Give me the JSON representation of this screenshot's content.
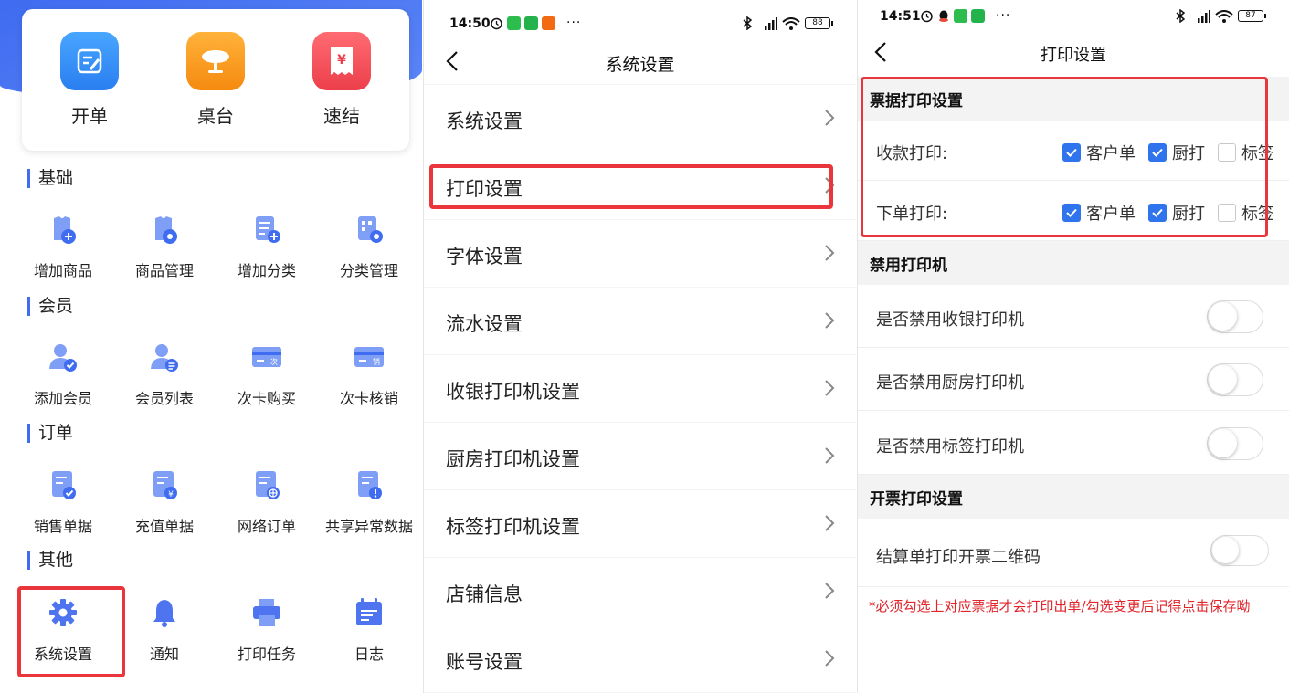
{
  "panel1": {
    "quick_actions": [
      {
        "label": "开单",
        "icon": "edit-order-icon",
        "color": "#2f8ef6"
      },
      {
        "label": "桌台",
        "icon": "table-icon",
        "color": "#f79a18"
      },
      {
        "label": "速结",
        "icon": "quick-checkout-icon",
        "color": "#f0505a"
      }
    ],
    "sections": [
      {
        "title": "基础",
        "items": [
          {
            "label": "增加商品",
            "icon": "add-product-icon"
          },
          {
            "label": "商品管理",
            "icon": "product-manage-icon"
          },
          {
            "label": "增加分类",
            "icon": "add-category-icon"
          },
          {
            "label": "分类管理",
            "icon": "category-manage-icon"
          }
        ]
      },
      {
        "title": "会员",
        "items": [
          {
            "label": "添加会员",
            "icon": "add-member-icon"
          },
          {
            "label": "会员列表",
            "icon": "member-list-icon"
          },
          {
            "label": "次卡购买",
            "icon": "card-buy-icon",
            "badge": "次"
          },
          {
            "label": "次卡核销",
            "icon": "card-redeem-icon",
            "badge": "销"
          }
        ]
      },
      {
        "title": "订单",
        "items": [
          {
            "label": "销售单据",
            "icon": "sales-doc-icon"
          },
          {
            "label": "充值单据",
            "icon": "recharge-doc-icon"
          },
          {
            "label": "网络订单",
            "icon": "online-order-icon"
          },
          {
            "label": "共享异常数据",
            "icon": "exception-data-icon"
          }
        ]
      },
      {
        "title": "其他",
        "items": [
          {
            "label": "系统设置",
            "icon": "gear-icon"
          },
          {
            "label": "通知",
            "icon": "bell-icon"
          },
          {
            "label": "打印任务",
            "icon": "printer-icon"
          },
          {
            "label": "日志",
            "icon": "calendar-log-icon"
          }
        ]
      }
    ],
    "accent": "#3f6cf0",
    "highlight": "#e9353b"
  },
  "panel2": {
    "status": {
      "time": "14:50",
      "battery": "88"
    },
    "title": "系统设置",
    "items": [
      {
        "label": "系统设置"
      },
      {
        "label": "打印设置"
      },
      {
        "label": "字体设置"
      },
      {
        "label": "流水设置"
      },
      {
        "label": "收银打印机设置"
      },
      {
        "label": "厨房打印机设置"
      },
      {
        "label": "标签打印机设置"
      },
      {
        "label": "店铺信息"
      },
      {
        "label": "账号设置"
      }
    ]
  },
  "panel3": {
    "status": {
      "time": "14:51",
      "battery": "87"
    },
    "title": "打印设置",
    "receipt_group": {
      "title": "票据打印设置",
      "rows": [
        {
          "label": "收款打印:",
          "options": [
            {
              "label": "客户单",
              "checked": true
            },
            {
              "label": "厨打",
              "checked": true
            },
            {
              "label": "标签",
              "checked": false
            }
          ]
        },
        {
          "label": "下单打印:",
          "options": [
            {
              "label": "客户单",
              "checked": true
            },
            {
              "label": "厨打",
              "checked": true
            },
            {
              "label": "标签",
              "checked": false
            }
          ]
        }
      ]
    },
    "disable_group": {
      "title": "禁用打印机",
      "rows": [
        {
          "label": "是否禁用收银打印机",
          "on": false
        },
        {
          "label": "是否禁用厨房打印机",
          "on": false
        },
        {
          "label": "是否禁用标签打印机",
          "on": false
        }
      ]
    },
    "invoice_group": {
      "title": "开票打印设置",
      "rows": [
        {
          "label": "结算单打印开票二维码",
          "on": false
        }
      ]
    },
    "note": "*必须勾选上对应票据才会打印出单/勾选变更后记得点击保存呦"
  }
}
